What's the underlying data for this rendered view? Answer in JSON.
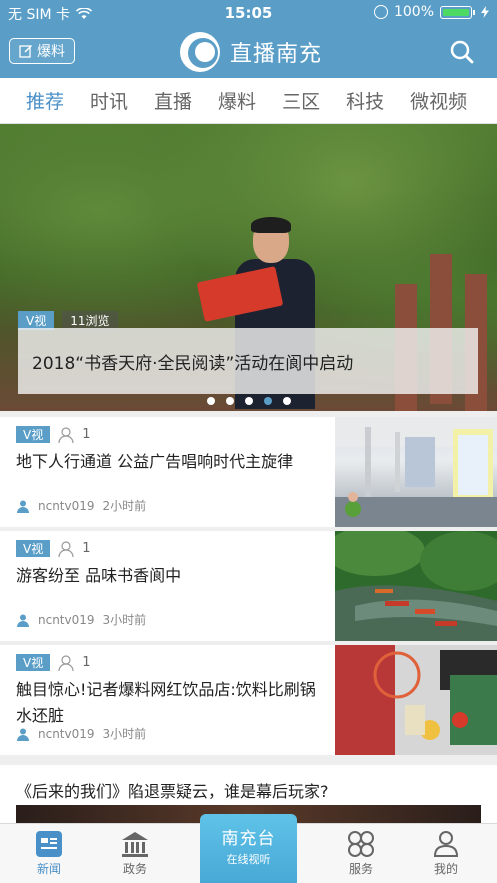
{
  "status_bar": {
    "carrier": "无 SIM 卡",
    "time": "15:05",
    "battery": "100%"
  },
  "header": {
    "baoliao_label": "爆料",
    "app_title": "直播南充",
    "brand_color": "#5a9ec8"
  },
  "tabs": [
    {
      "label": "推荐",
      "active": true
    },
    {
      "label": "时讯"
    },
    {
      "label": "直播"
    },
    {
      "label": "爆料"
    },
    {
      "label": "三区"
    },
    {
      "label": "科技"
    },
    {
      "label": "微视频"
    }
  ],
  "hero": {
    "tag": "V视",
    "views": "11浏览",
    "caption": "2018“书香天府·全民阅读”活动在阆中启动",
    "dots_total": 5,
    "dots_active": 4
  },
  "news": [
    {
      "tag": "V视",
      "count": "1",
      "title": "地下人行通道 公益广告唱响时代主旋律",
      "author": "ncntv019",
      "time": "2小时前"
    },
    {
      "tag": "V视",
      "count": "1",
      "title": "游客纷至 品味书香阆中",
      "author": "ncntv019",
      "time": "3小时前"
    },
    {
      "tag": "V视",
      "count": "1",
      "title": "触目惊心!记者爆料网红饮品店:饮料比刷锅水还脏",
      "author": "ncntv019",
      "time": "3小时前"
    }
  ],
  "featured": {
    "title": "《后来的我们》陷退票疑云，谁是幕后玩家?"
  },
  "tabbar": {
    "news": "新闻",
    "gov": "政务",
    "center_title": "南充台",
    "center_sub": "在线视听",
    "service": "服务",
    "mine": "我的"
  }
}
